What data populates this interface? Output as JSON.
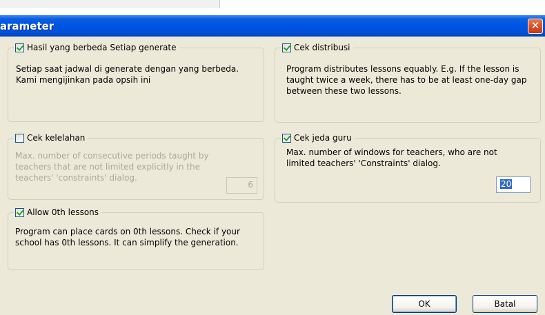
{
  "window": {
    "title": "arameter",
    "close_glyph": "✕"
  },
  "groups": {
    "hasil": {
      "label": "Hasil yang berbeda Setiap generate",
      "checked": true,
      "description": "Setiap saat jadwal di generate dengan yang berbeda. Kami mengijinkan pada opsih ini"
    },
    "distribusi": {
      "label": "Cek distribusi",
      "checked": true,
      "description": "Program distributes lessons equably. E.g. If the lesson is taught twice a week, there has to be at least one-day gap between these two lessons."
    },
    "kelelahan": {
      "label": "Cek kelelahan",
      "checked": false,
      "disabled_description": true,
      "description": "Max. number of consecutive periods taught by teachers that are not limited explicitly in the teachers' 'constraints' dialog.",
      "value": "6"
    },
    "jeda": {
      "label": "Cek jeda guru",
      "checked": true,
      "description": "Max. number of windows for teachers, who are not limited teachers' 'Constraints' dialog.",
      "value": "20"
    },
    "zero": {
      "label": "Allow 0th lessons",
      "checked": true,
      "description": "Program can place cards on 0th lessons. Check if your school has 0th lessons. It can simplify the generation."
    }
  },
  "buttons": {
    "ok": "OK",
    "cancel": "Batal"
  },
  "colors": {
    "titlebar": "#0054e3",
    "dialog_bg": "#ece9d8",
    "check_mark": "#21a121",
    "selection": "#316ac5"
  }
}
